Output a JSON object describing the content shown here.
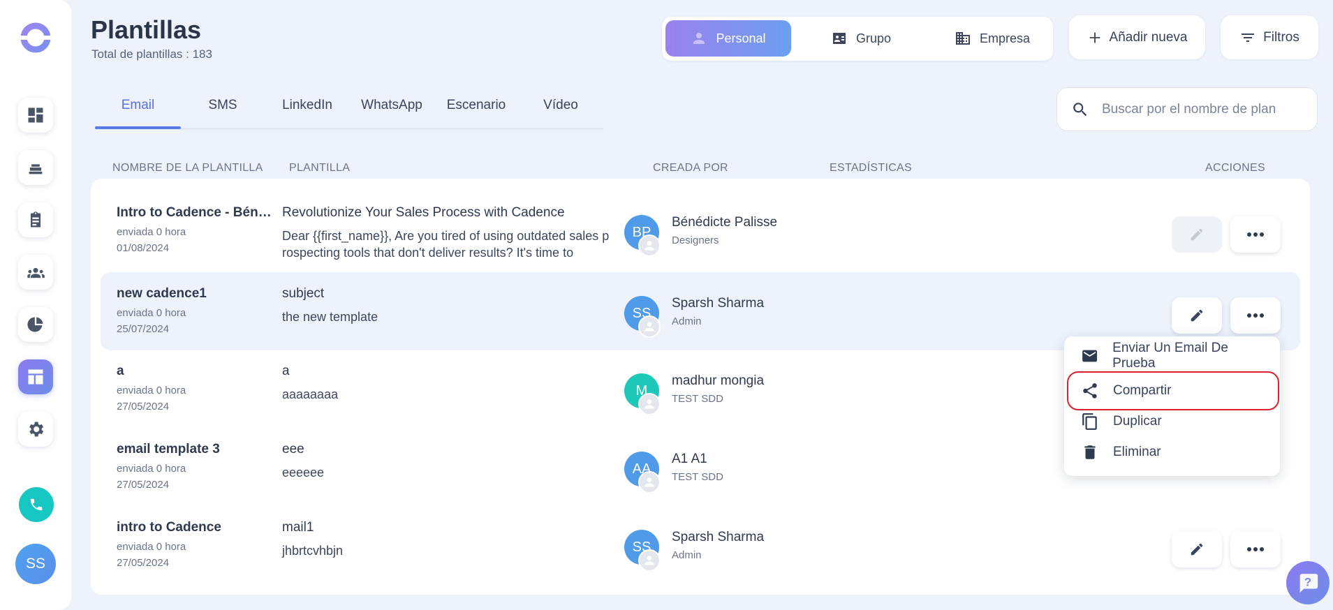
{
  "header": {
    "title": "Plantillas",
    "subtitle": "Total de plantillas : 183"
  },
  "scope": {
    "items": [
      {
        "label": "Personal",
        "icon": "user-icon",
        "active": true
      },
      {
        "label": "Grupo",
        "icon": "id-card-icon",
        "active": false
      },
      {
        "label": "Empresa",
        "icon": "building-icon",
        "active": false
      }
    ]
  },
  "actions": {
    "add_label": "Añadir nueva",
    "filter_label": "Filtros"
  },
  "tabs": [
    {
      "label": "Email",
      "active": true
    },
    {
      "label": "SMS"
    },
    {
      "label": "LinkedIn"
    },
    {
      "label": "WhatsApp"
    },
    {
      "label": "Escenario"
    },
    {
      "label": "Vídeo"
    }
  ],
  "search": {
    "placeholder": "Buscar por el nombre de plan"
  },
  "table": {
    "columns": [
      "NOMBRE DE LA PLANTILLA",
      "PLANTILLA",
      "CREADA POR",
      "ESTADÍSTICAS",
      "ACCIONES"
    ],
    "rows": [
      {
        "name": "Intro to Cadence - Bénédicte",
        "sent": "enviada 0 hora",
        "date": "01/08/2024",
        "subject": "Revolutionize Your Sales Process with Cadence",
        "body": "Dear {{first_name}},   Are you tired of using outdated sales prospecting tools that don't deliver results? It's time to",
        "initials": "BP",
        "creator": "Bénédicte Palisse",
        "role": "Designers",
        "avatar_color": "#4f9be9"
      },
      {
        "name": "new cadence1",
        "sent": "enviada 0 hora",
        "date": "25/07/2024",
        "subject": "subject",
        "body": "the new template",
        "initials": "SS",
        "creator": "Sparsh Sharma",
        "role": "Admin",
        "avatar_color": "#4f9be9"
      },
      {
        "name": "a",
        "sent": "enviada 0 hora",
        "date": "27/05/2024",
        "subject": "a",
        "body": "aaaaaaaa",
        "initials": "M",
        "creator": "madhur mongia",
        "role": "TEST SDD",
        "avatar_color": "#1ec8b8"
      },
      {
        "name": "email template 3",
        "sent": "enviada 0 hora",
        "date": "27/05/2024",
        "subject": "eee",
        "body": "eeeeee",
        "initials": "AA",
        "creator": "A1 A1",
        "role": "TEST SDD",
        "avatar_color": "#4f9be9"
      },
      {
        "name": "intro to Cadence",
        "sent": "enviada 0 hora",
        "date": "27/05/2024",
        "subject": "mail1",
        "body": "jhbrtcvhbjn",
        "initials": "SS",
        "creator": "Sparsh Sharma",
        "role": "Admin",
        "avatar_color": "#4f9be9"
      }
    ]
  },
  "menu": {
    "items": [
      {
        "label": "Enviar Un Email De Prueba",
        "icon": "envelope-icon"
      },
      {
        "label": "Compartir",
        "icon": "share-icon"
      },
      {
        "label": "Duplicar",
        "icon": "copy-icon"
      },
      {
        "label": "Eliminar",
        "icon": "trash-icon"
      }
    ]
  },
  "user": {
    "initials": "SS"
  },
  "colors": {
    "accent": "#5b7ce6",
    "highlight": "#e0202a",
    "teal": "#15c6c1"
  }
}
